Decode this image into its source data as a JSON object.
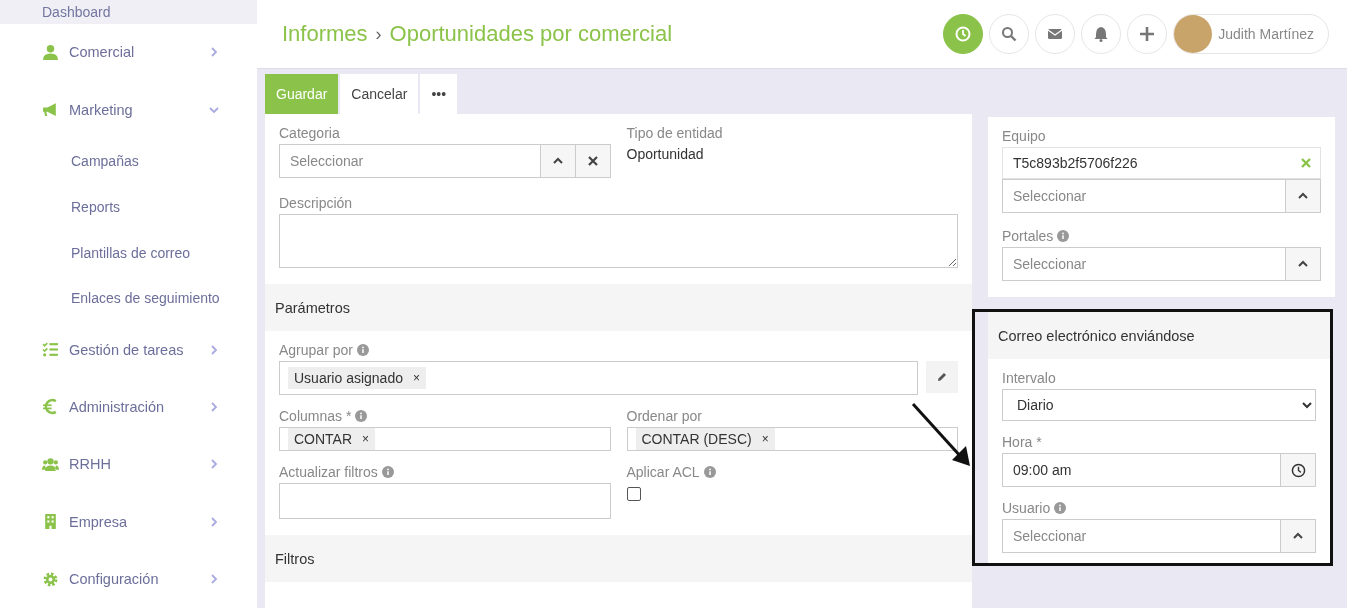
{
  "sidebar": {
    "items": [
      {
        "label": "Dashboard"
      },
      {
        "label": "Comercial",
        "expanded": false
      },
      {
        "label": "Marketing",
        "expanded": true,
        "children": [
          {
            "label": "Campañas"
          },
          {
            "label": "Reports"
          },
          {
            "label": "Plantillas de correo"
          },
          {
            "label": "Enlaces de seguimiento"
          }
        ]
      },
      {
        "label": "Gestión de tareas",
        "expanded": false
      },
      {
        "label": "Administración",
        "expanded": false
      },
      {
        "label": "RRHH",
        "expanded": false
      },
      {
        "label": "Empresa",
        "expanded": false
      },
      {
        "label": "Configuración",
        "expanded": false
      }
    ]
  },
  "header": {
    "breadcrumb": [
      "Informes",
      "Oportunidades por comercial"
    ],
    "separator": "›",
    "user": "Judith Martínez"
  },
  "toolbar": {
    "buttons": [
      {
        "label": "Guardar",
        "kind": "primary"
      },
      {
        "label": "Cancelar",
        "kind": "default"
      },
      {
        "label": "•••",
        "kind": "default"
      }
    ]
  },
  "form": {
    "categoria": {
      "label": "Categoria",
      "placeholder": "Seleccionar"
    },
    "tipo_de_entidad": {
      "label": "Tipo de entidad",
      "value": "Oportunidad"
    },
    "descripcion": {
      "label": "Descripción"
    },
    "parametros": {
      "title": "Parámetros",
      "agrupar_por": {
        "label": "Agrupar por",
        "tags": [
          "Usuario asignado"
        ]
      },
      "columnas": {
        "label": "Columnas *",
        "tags": [
          "CONTAR"
        ]
      },
      "ordenar_por": {
        "label": "Ordenar por",
        "tags": [
          "CONTAR (DESC)"
        ]
      },
      "actualizar_filtros": {
        "label": "Actualizar filtros"
      },
      "aplicar_acl": {
        "label": "Aplicar ACL",
        "checked": false
      }
    },
    "filtros": {
      "title": "Filtros"
    }
  },
  "side_panel": {
    "equipo": {
      "label": "Equipo",
      "value": "T5c893b2f5706f226",
      "placeholder": "Seleccionar"
    },
    "portales": {
      "label": "Portales",
      "placeholder": "Seleccionar"
    }
  },
  "email_panel": {
    "title": "Correo electrónico enviándose",
    "intervalo": {
      "label": "Intervalo",
      "value": "Diario"
    },
    "hora": {
      "label": "Hora *",
      "value": "09:00 am"
    },
    "usuario": {
      "label": "Usuario",
      "placeholder": "Seleccionar"
    }
  },
  "tag_remove": "×"
}
